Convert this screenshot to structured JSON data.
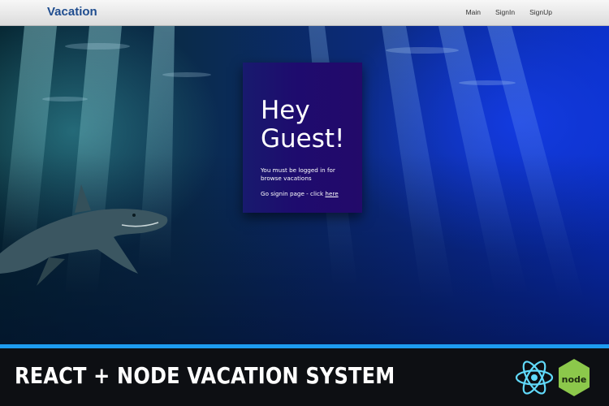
{
  "navbar": {
    "brand": "Vacation",
    "links": [
      "Main",
      "SignIn",
      "SignUp"
    ]
  },
  "card": {
    "title_line1": "Hey",
    "title_line2": "Guest!",
    "message": "You must be logged in for browse vacations",
    "link_prefix": "Go signin page - click ",
    "link_text": "here"
  },
  "banner": {
    "title": "REACT + NODE VACATION SYSTEM",
    "logos": {
      "react": {
        "icon": "react-logo-icon",
        "color": "#61dafb"
      },
      "node": {
        "icon": "node-logo-icon",
        "text": "node",
        "color": "#8cc84b"
      }
    }
  },
  "colors": {
    "brand": "#1f4d8f",
    "accent_stripe": "#1d9cf0",
    "card_bg": "#1e0b6e",
    "banner_bg": "#0d0f13"
  }
}
